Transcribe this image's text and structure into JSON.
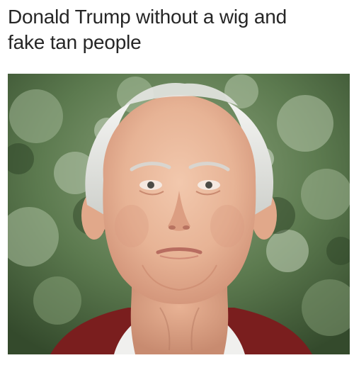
{
  "caption": {
    "line1": "Donald Trump without a wig and",
    "line2": "fake tan people"
  },
  "photo": {
    "subject": "elderly man portrait photo",
    "background_color": "#5b7a4f",
    "skin_color": "#e9b89c",
    "hair_color": "#e8e8e6",
    "sweater_color": "#7e1f1f",
    "shirt_color": "#f1f1ef"
  }
}
